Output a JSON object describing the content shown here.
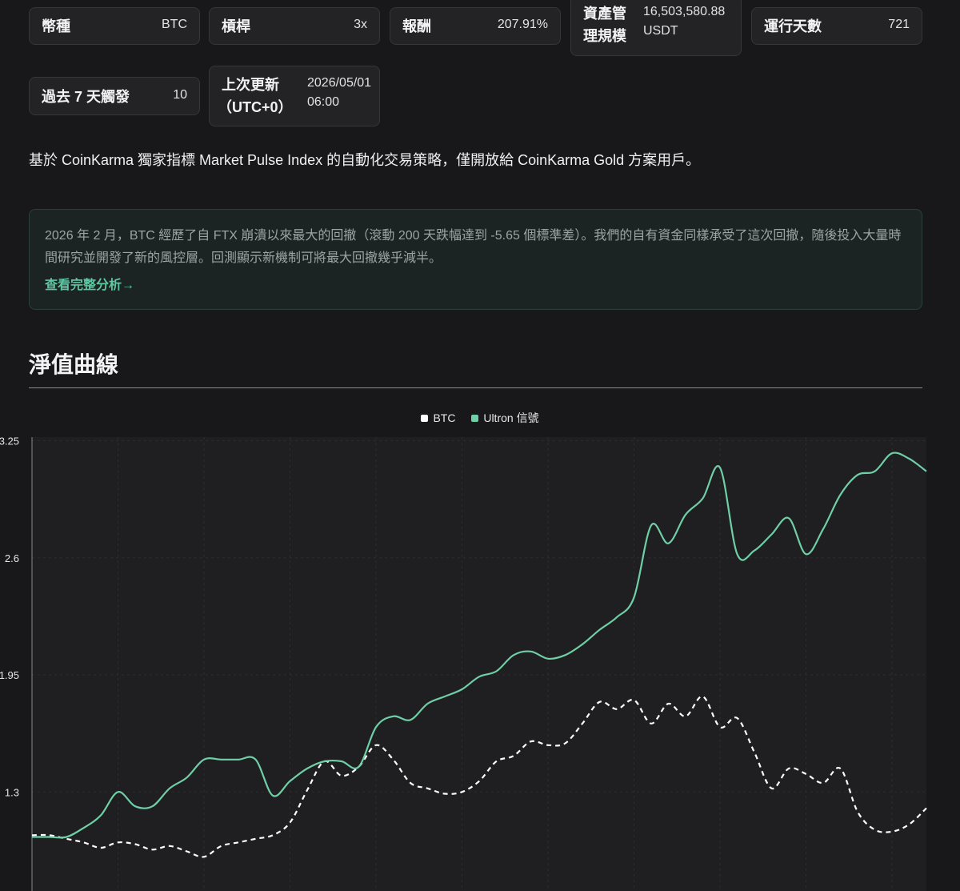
{
  "stats": {
    "currency": {
      "label": "幣種",
      "value": "BTC"
    },
    "leverage": {
      "label": "槓桿",
      "value": "3x"
    },
    "return": {
      "label": "報酬",
      "value": "207.91%"
    },
    "aum": {
      "label_line1": "資產管",
      "label_line2": "理規模",
      "value_line1": "16,503,580.88",
      "value_line2": "USDT"
    },
    "days": {
      "label": "運行天數",
      "value": "721"
    },
    "triggers": {
      "label": "過去 7 天觸發",
      "value": "10"
    },
    "updated": {
      "label_line1": "上次更新",
      "label_line2": "（UTC+0）",
      "value_line1": "2026/05/01",
      "value_line2": "06:00"
    }
  },
  "description": "基於 CoinKarma 獨家指標 Market Pulse Index 的自動化交易策略，僅開放給 CoinKarma Gold 方案用戶。",
  "notice": {
    "text": "2026 年 2 月，BTC 經歷了自 FTX 崩潰以來最大的回撤（滾動 200 天跌幅達到 -5.65 個標準差）。我們的自有資金同樣承受了這次回撤，隨後投入大量時間研究並開發了新的風控層。回測顯示新機制可將最大回撤幾乎減半。",
    "link": "查看完整分析→"
  },
  "section_title": "淨值曲線",
  "colors": {
    "btc": "#ffffff",
    "ultron": "#6fcfa6",
    "accent": "#5ec7a2"
  },
  "chart_data": {
    "type": "line",
    "title": "",
    "legend": [
      "BTC",
      "Ultron 信號"
    ],
    "legend_position": "top-center",
    "y_tick_labels": [
      "3.25",
      "2.6",
      "1.95",
      "1.3"
    ],
    "y_ticks": [
      3.25,
      2.6,
      1.95,
      1.3
    ],
    "ylim": [
      0.75,
      3.27
    ],
    "xlim": [
      0,
      104
    ],
    "grid": true,
    "series": [
      {
        "name": "BTC",
        "style": "dashed",
        "x": [
          0,
          2,
          4,
          6,
          8,
          10,
          12,
          14,
          16,
          18,
          20,
          22,
          24,
          26,
          28,
          30,
          32,
          34,
          36,
          38,
          40,
          42,
          44,
          46,
          48,
          50,
          52,
          54,
          56,
          58,
          60,
          62,
          64,
          66,
          68,
          70,
          72,
          74,
          76,
          78,
          80,
          82,
          84,
          86,
          88,
          90,
          92,
          94,
          96,
          98,
          100,
          102,
          104
        ],
        "values": [
          1.06,
          1.06,
          1.04,
          1.02,
          0.99,
          1.02,
          1.01,
          0.98,
          1.0,
          0.97,
          0.94,
          1.0,
          1.02,
          1.04,
          1.06,
          1.13,
          1.31,
          1.47,
          1.39,
          1.44,
          1.56,
          1.48,
          1.35,
          1.32,
          1.29,
          1.3,
          1.36,
          1.47,
          1.5,
          1.58,
          1.56,
          1.57,
          1.68,
          1.8,
          1.76,
          1.81,
          1.68,
          1.79,
          1.72,
          1.83,
          1.66,
          1.71,
          1.52,
          1.32,
          1.43,
          1.4,
          1.35,
          1.43,
          1.19,
          1.09,
          1.08,
          1.12,
          1.21
        ]
      },
      {
        "name": "Ultron 信號",
        "style": "solid",
        "x": [
          0,
          2,
          4,
          6,
          8,
          10,
          12,
          14,
          16,
          18,
          20,
          22,
          24,
          26,
          28,
          30,
          32,
          34,
          36,
          38,
          40,
          42,
          44,
          46,
          48,
          50,
          52,
          54,
          56,
          58,
          60,
          62,
          64,
          66,
          68,
          70,
          72,
          74,
          76,
          78,
          80,
          82,
          84,
          86,
          88,
          90,
          92,
          94,
          96,
          98,
          100,
          102,
          104
        ],
        "values": [
          1.05,
          1.05,
          1.05,
          1.1,
          1.17,
          1.3,
          1.22,
          1.22,
          1.32,
          1.38,
          1.48,
          1.48,
          1.48,
          1.48,
          1.28,
          1.36,
          1.43,
          1.47,
          1.47,
          1.44,
          1.66,
          1.72,
          1.7,
          1.79,
          1.83,
          1.87,
          1.94,
          1.97,
          2.06,
          2.08,
          2.04,
          2.06,
          2.12,
          2.2,
          2.27,
          2.38,
          2.78,
          2.68,
          2.84,
          2.93,
          3.1,
          2.62,
          2.64,
          2.73,
          2.82,
          2.62,
          2.76,
          2.95,
          3.06,
          3.08,
          3.18,
          3.15,
          3.08
        ]
      }
    ]
  }
}
